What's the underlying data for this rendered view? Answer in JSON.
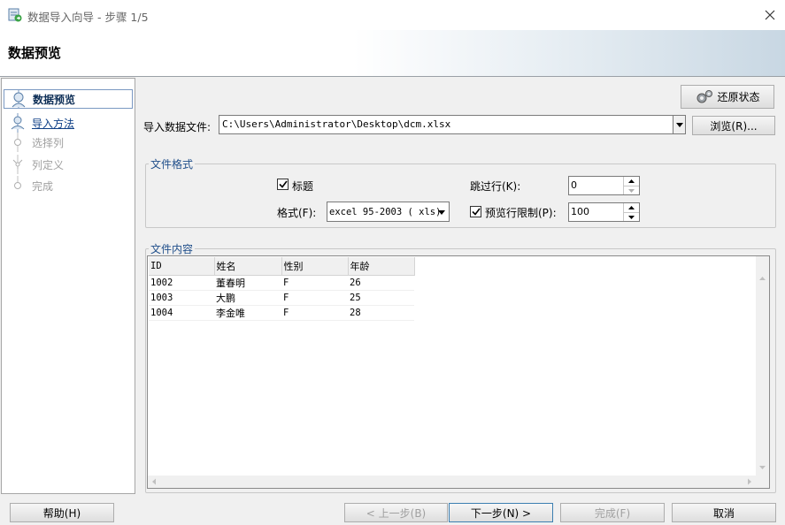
{
  "window": {
    "title": "数据导入向导 - 步骤 1/5",
    "header_title": "数据预览"
  },
  "steps": [
    {
      "label": "数据预览",
      "state": "current"
    },
    {
      "label": "导入方法",
      "state": "link"
    },
    {
      "label": "选择列",
      "state": "disabled"
    },
    {
      "label": "列定义",
      "state": "disabled"
    },
    {
      "label": "完成",
      "state": "disabled"
    }
  ],
  "toolbar": {
    "restore_label": "还原状态"
  },
  "file": {
    "label": "导入数据文件:",
    "path": "C:\\Users\\Administrator\\Desktop\\dcm.xlsx",
    "browse_label": "浏览(R)..."
  },
  "format_group": {
    "title": "文件格式",
    "header_checkbox_label": "标题",
    "header_checked": true,
    "format_label": "格式(F):",
    "format_value": "excel 95-2003 ( xls)",
    "skip_rows_label": "跳过行(K):",
    "skip_rows_value": "0",
    "preview_limit_label": "预览行限制(P):",
    "preview_limit_checked": true,
    "preview_limit_value": "100"
  },
  "content_group": {
    "title": "文件内容",
    "columns": [
      "ID",
      "姓名",
      "性别",
      "年龄"
    ],
    "rows": [
      [
        "1002",
        "董春明",
        "F",
        "26"
      ],
      [
        "1003",
        "大鹏",
        "F",
        "25"
      ],
      [
        "1004",
        "李金唯",
        "F",
        "28"
      ]
    ]
  },
  "footer": {
    "help_label": "帮助(H)",
    "back_label": "< 上一步(B)",
    "next_label": "下一步(N) >",
    "finish_label": "完成(F)",
    "cancel_label": "取消"
  },
  "colors": {
    "accent": "#1f4e8a",
    "link": "#0e3f86",
    "disabled": "#a0a0a0"
  }
}
